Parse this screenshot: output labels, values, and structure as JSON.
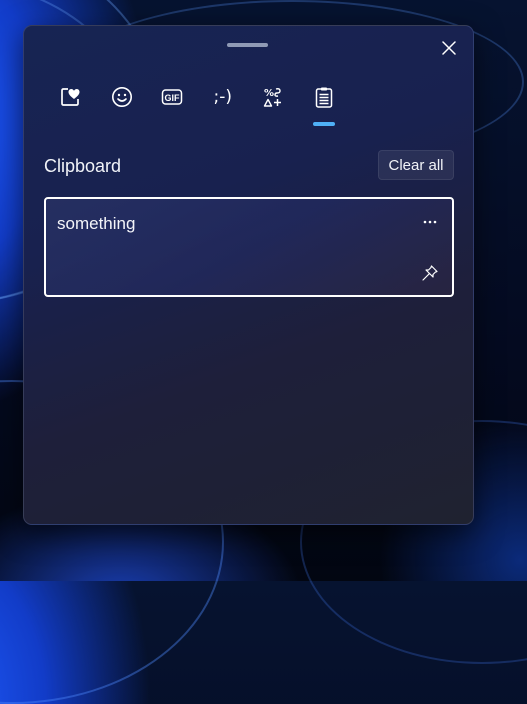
{
  "window": {
    "title": "Clipboard",
    "close_label": "Close"
  },
  "tabs": [
    {
      "label": "Most recently used",
      "icon": "heart-sticker-icon"
    },
    {
      "label": "Emoji",
      "icon": "smiley-icon"
    },
    {
      "label": "GIF",
      "icon": "gif-icon",
      "glyph": "GIF"
    },
    {
      "label": "Kaomoji",
      "icon": "kaomoji-icon",
      "glyph": ";-)"
    },
    {
      "label": "Symbols",
      "icon": "symbols-icon"
    },
    {
      "label": "Clipboard history",
      "icon": "clipboard-icon",
      "active": true
    }
  ],
  "section": {
    "title": "Clipboard",
    "clear_all_label": "Clear all"
  },
  "clipboard_items": [
    {
      "text": "something",
      "more_icon": "more-icon",
      "pin_icon": "pin-icon",
      "selected": true
    }
  ],
  "colors": {
    "accent": "#4fb0f6",
    "panel_background": "#18214f",
    "text": "#ffffff",
    "item_border": "#ffffff"
  }
}
